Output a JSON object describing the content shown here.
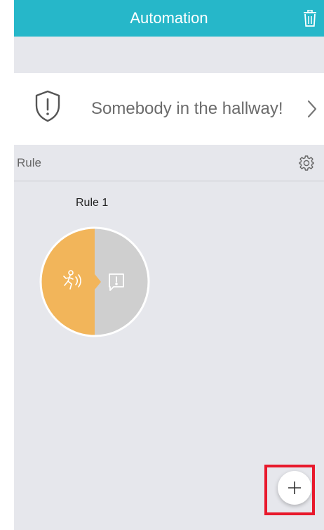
{
  "header": {
    "title": "Automation",
    "trash_icon": "trash-icon",
    "background_color": "#26b7c9"
  },
  "scene": {
    "name": "Somebody in the hallway!",
    "icon": "shield-alert-icon",
    "chevron_icon": "chevron-right-icon"
  },
  "rules_section": {
    "label": "Rule",
    "settings_icon": "gear-icon"
  },
  "rules": [
    {
      "title": "Rule 1",
      "trigger_icon": "motion-sensor-icon",
      "action_icon": "notification-icon",
      "trigger_color": "#f2b55a",
      "action_color": "#cfcfcf"
    }
  ],
  "fab": {
    "icon": "plus-icon",
    "highlight_color": "#e8192c"
  }
}
